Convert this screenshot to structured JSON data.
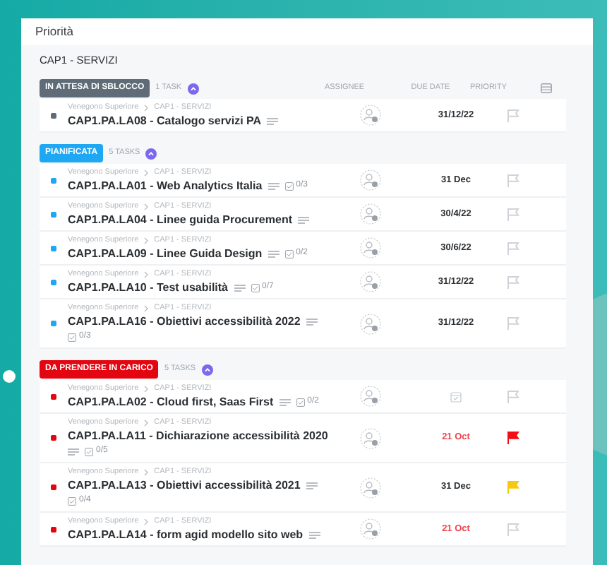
{
  "page_title": "Priorità",
  "section_title": "CAP1 - SERVIZI",
  "columns": [
    "ASSIGNEE",
    "DUE DATE",
    "PRIORITY"
  ],
  "groups": [
    {
      "status": "IN ATTESA DI SBLOCCO",
      "color": "#5f6b76",
      "count": "1 TASK",
      "tasks": [
        {
          "location": "Venegono Superiore",
          "folder": "CAP1 - SERVIZI",
          "title": "CAP1.PA.LA08 - Catalogo servizi PA",
          "description": true,
          "due": "31/12/22",
          "overdue": false
        }
      ]
    },
    {
      "status": "PIANIFICATA",
      "color": "#1ea7f2",
      "count": "5 TASKS",
      "tasks": [
        {
          "location": "Venegono Superiore",
          "folder": "CAP1 - SERVIZI",
          "title": "CAP1.PA.LA01 - Web Analytics Italia",
          "description": true,
          "checklist": "0/3",
          "due": "31 Dec",
          "overdue": false
        },
        {
          "location": "Venegono Superiore",
          "folder": "CAP1 - SERVIZI",
          "title": "CAP1.PA.LA04 - Linee guida Procurement",
          "description": true,
          "due": "30/4/22",
          "overdue": false
        },
        {
          "location": "Venegono Superiore",
          "folder": "CAP1 - SERVIZI",
          "title": "CAP1.PA.LA09 - Linee Guida Design",
          "description": true,
          "checklist": "0/2",
          "due": "30/6/22",
          "overdue": false
        },
        {
          "location": "Venegono Superiore",
          "folder": "CAP1 - SERVIZI",
          "title": "CAP1.PA.LA10 - Test usabilità",
          "description": true,
          "checklist": "0/7",
          "due": "31/12/22",
          "overdue": false
        },
        {
          "location": "Venegono Superiore",
          "folder": "CAP1 - SERVIZI",
          "title": "CAP1.PA.LA16 - Obiettivi accessibilità 2022",
          "description": true,
          "checklist": "0/3",
          "due": "31/12/22",
          "overdue": false
        }
      ]
    },
    {
      "status": "DA PRENDERE IN CARICO",
      "color": "#e3050f",
      "count": "5 TASKS",
      "tasks": [
        {
          "location": "Venegono Superiore",
          "folder": "CAP1 - SERVIZI",
          "title": "CAP1.PA.LA02 - Cloud first, Saas First",
          "description": true,
          "checklist": "0/2"
        },
        {
          "location": "Venegono Superiore",
          "folder": "CAP1 - SERVIZI",
          "title": "CAP1.PA.LA11 - Dichiarazione accessibilità 2020",
          "description": true,
          "checklist": "0/5",
          "due": "21 Oct",
          "overdue": true,
          "flag": {
            "color": "#f40c16"
          }
        },
        {
          "location": "Venegono Superiore",
          "folder": "CAP1 - SERVIZI",
          "title": "CAP1.PA.LA13 - Obiettivi accessibilità 2021",
          "description": true,
          "checklist": "0/4",
          "due": "31 Dec",
          "overdue": false,
          "flag": {
            "color": "#f7c90c"
          }
        },
        {
          "location": "Venegono Superiore",
          "folder": "CAP1 - SERVIZI",
          "title": "CAP1.PA.LA14 - form agid modello sito web",
          "description": true,
          "due": "21 Oct",
          "overdue": true
        }
      ]
    }
  ]
}
